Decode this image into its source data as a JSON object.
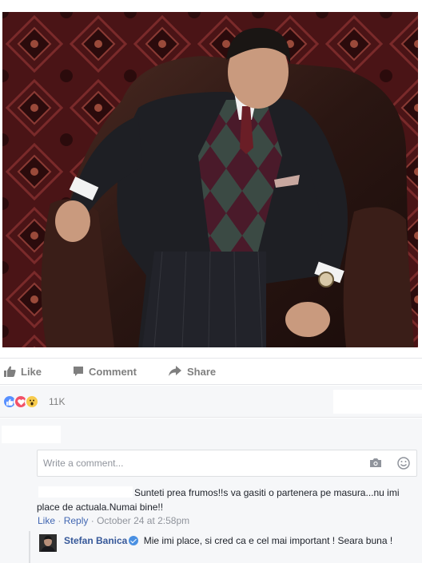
{
  "post": {
    "photo_alt": "photo"
  },
  "actions": {
    "like_label": "Like",
    "comment_label": "Comment",
    "share_label": "Share"
  },
  "reactions": {
    "icons": [
      "like-reaction",
      "love-reaction",
      "wow-reaction"
    ],
    "count": "11K"
  },
  "composer": {
    "placeholder": "Write a comment..."
  },
  "comments": [
    {
      "text": "Sunteti prea frumos!!s va gasiti o partenera pe masura...nu imi place de actuala.Numai bine!!",
      "like_label": "Like",
      "reply_label": "Reply",
      "separator": "·",
      "timestamp": "October 24 at 2:58pm"
    }
  ],
  "reply": {
    "author": "Stefan Banica",
    "text": "Mie imi place, si cred ca e cel mai important ! Seara buna !"
  },
  "colors": {
    "link_blue": "#365899",
    "muted": "#90949c",
    "accent": "#4267b2"
  }
}
